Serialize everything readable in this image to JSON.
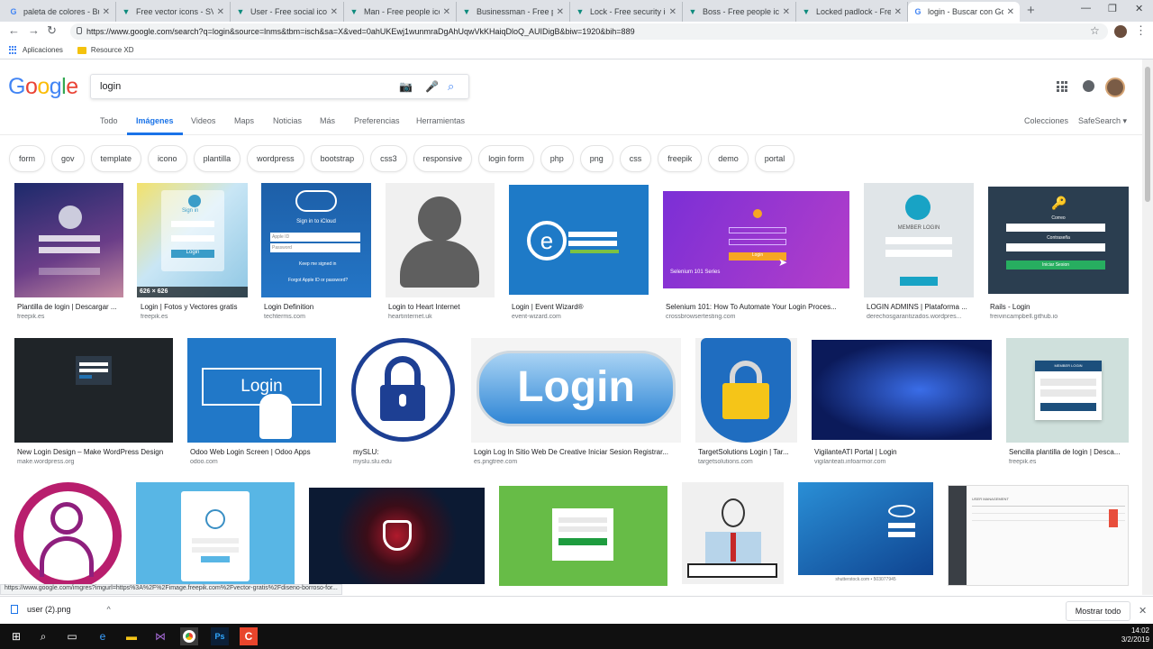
{
  "browser": {
    "tabs": [
      {
        "title": "paleta de colores - Bus",
        "icon": "google-g-icon",
        "fav_color": "#4285f4"
      },
      {
        "title": "Free vector icons - SVG",
        "icon": "flaticon-icon",
        "fav_color": "#0e8b7d"
      },
      {
        "title": "User - Free social icons",
        "icon": "flaticon-icon",
        "fav_color": "#0e8b7d"
      },
      {
        "title": "Man - Free people icon",
        "icon": "flaticon-icon",
        "fav_color": "#0e8b7d"
      },
      {
        "title": "Businessman - Free pe",
        "icon": "flaticon-icon",
        "fav_color": "#0e8b7d"
      },
      {
        "title": "Lock - Free security ico",
        "icon": "flaticon-icon",
        "fav_color": "#0e8b7d"
      },
      {
        "title": "Boss - Free people icon",
        "icon": "flaticon-icon",
        "fav_color": "#0e8b7d"
      },
      {
        "title": "Locked padlock - Free",
        "icon": "flaticon-icon",
        "fav_color": "#0e8b7d"
      },
      {
        "title": "login - Buscar con Goo",
        "icon": "google-g-icon",
        "fav_color": "#4285f4",
        "active": true
      }
    ],
    "url": "https://www.google.com/search?q=login&source=lnms&tbm=isch&sa=X&ved=0ahUKEwj1wunmraDgAhUqwVkKHaiqDloQ_AUIDigB&biw=1920&bih=889",
    "bookmarks": {
      "apps": "Aplicaciones",
      "folder": "Resource XD"
    }
  },
  "google": {
    "logo": [
      "G",
      "o",
      "o",
      "g",
      "l",
      "e"
    ],
    "logo_colors": [
      "#4285f4",
      "#ea4335",
      "#fbbc05",
      "#4285f4",
      "#34a853",
      "#ea4335"
    ],
    "query": "login",
    "tabs": [
      "Todo",
      "Imágenes",
      "Videos",
      "Maps",
      "Noticias",
      "Más",
      "Preferencias",
      "Herramientas"
    ],
    "right_links": {
      "collections": "Colecciones",
      "safesearch": "SafeSearch ▾"
    },
    "chips": [
      "form",
      "gov",
      "template",
      "icono",
      "plantilla",
      "wordpress",
      "bootstrap",
      "css3",
      "responsive",
      "login form",
      "php",
      "png",
      "css",
      "freepik",
      "demo",
      "portal"
    ]
  },
  "results": {
    "row1": [
      {
        "caption": "Plantilla de login | Descargar ...",
        "source": "freepik.es"
      },
      {
        "caption": "Login | Fotos y Vectores gratis",
        "source": "freepik.es",
        "overlay": "626 × 626"
      },
      {
        "caption": "Login Definition",
        "source": "techterms.com"
      },
      {
        "caption": "Login to Heart Internet",
        "source": "heartinternet.uk"
      },
      {
        "caption": "Login | Event Wizard®",
        "source": "event-wizard.com"
      },
      {
        "caption": "Selenium 101: How To Automate Your Login Proces...",
        "source": "crossbrowsertesting.com"
      },
      {
        "caption": "LOGIN ADMINS | Plataforma ...",
        "source": "derechosgarantizados.wordpres..."
      },
      {
        "caption": "Rails - Login",
        "source": "freivincampbell.github.io"
      }
    ],
    "row2": [
      {
        "caption": "New Login Design – Make WordPress Design",
        "source": "make.wordpress.org"
      },
      {
        "caption": "Odoo Web Login Screen | Odoo Apps",
        "source": "odoo.com"
      },
      {
        "caption": "mySLU:",
        "source": "myslu.slu.edu"
      },
      {
        "caption": "Login Log In Sitio Web De Creative Iniciar Sesion Registrar...",
        "source": "es.pngtree.com"
      },
      {
        "caption": "TargetSolutions Login | Tar...",
        "source": "targetsolutions.com"
      },
      {
        "caption": "VigilanteATI Portal | Login",
        "source": "vigilanteati.infoarmor.com"
      },
      {
        "caption": "Sencilla plantilla de login | Desca...",
        "source": "freepik.es"
      }
    ],
    "texts": {
      "signin": "Sign in",
      "signin_icloud": "Sign in to iCloud",
      "apple_id": "Apple ID",
      "password": "Password",
      "keep": "Keep me signed in",
      "forgot": "Forgot Apple ID or password?",
      "login_btn": "Login",
      "member_login": "MEMBER LOGIN",
      "selenium": "Selenium 101 Series",
      "correo": "Correo",
      "contrasena": "Contraseña",
      "iniciar": "Iniciar Sesion",
      "big_login": "Login",
      "shutterstock": "shutterstock.com • 503077945",
      "user_mgmt": "USER MANAGEMENT"
    }
  },
  "status_url": "https://www.google.com/imgres?imgurl=https%3A%2F%2Fimage.freepik.com%2Fvector-gratis%2Fdiseno-borroso-for...",
  "download": {
    "file": "user (2).png",
    "show_all": "Mostrar todo"
  },
  "clock": {
    "time": "14:02",
    "date": "3/2/2019"
  }
}
